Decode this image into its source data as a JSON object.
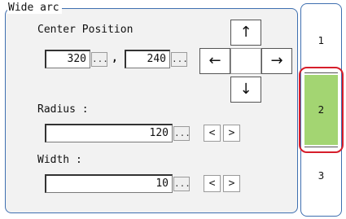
{
  "group": {
    "title": "Wide arc"
  },
  "center": {
    "label": "Center Position",
    "x_value": "320",
    "separator": ",",
    "y_value": "240",
    "ellipsis": "..."
  },
  "arrows": {
    "up": "↑",
    "left": "←",
    "right": "→",
    "down": "↓"
  },
  "radius": {
    "label": "Radius :",
    "value": "120",
    "ellipsis": "...",
    "decrease": "<",
    "increase": ">"
  },
  "width": {
    "label": "Width :",
    "value": "10",
    "ellipsis": "...",
    "decrease": "<",
    "increase": ">"
  },
  "tabs": [
    {
      "label": "1",
      "selected": false
    },
    {
      "label": "2",
      "selected": true
    },
    {
      "label": "3",
      "selected": false
    }
  ],
  "colors": {
    "frame": "#3e6fb0",
    "selected_tab": "#a3d572",
    "highlight": "#d61e2b"
  }
}
